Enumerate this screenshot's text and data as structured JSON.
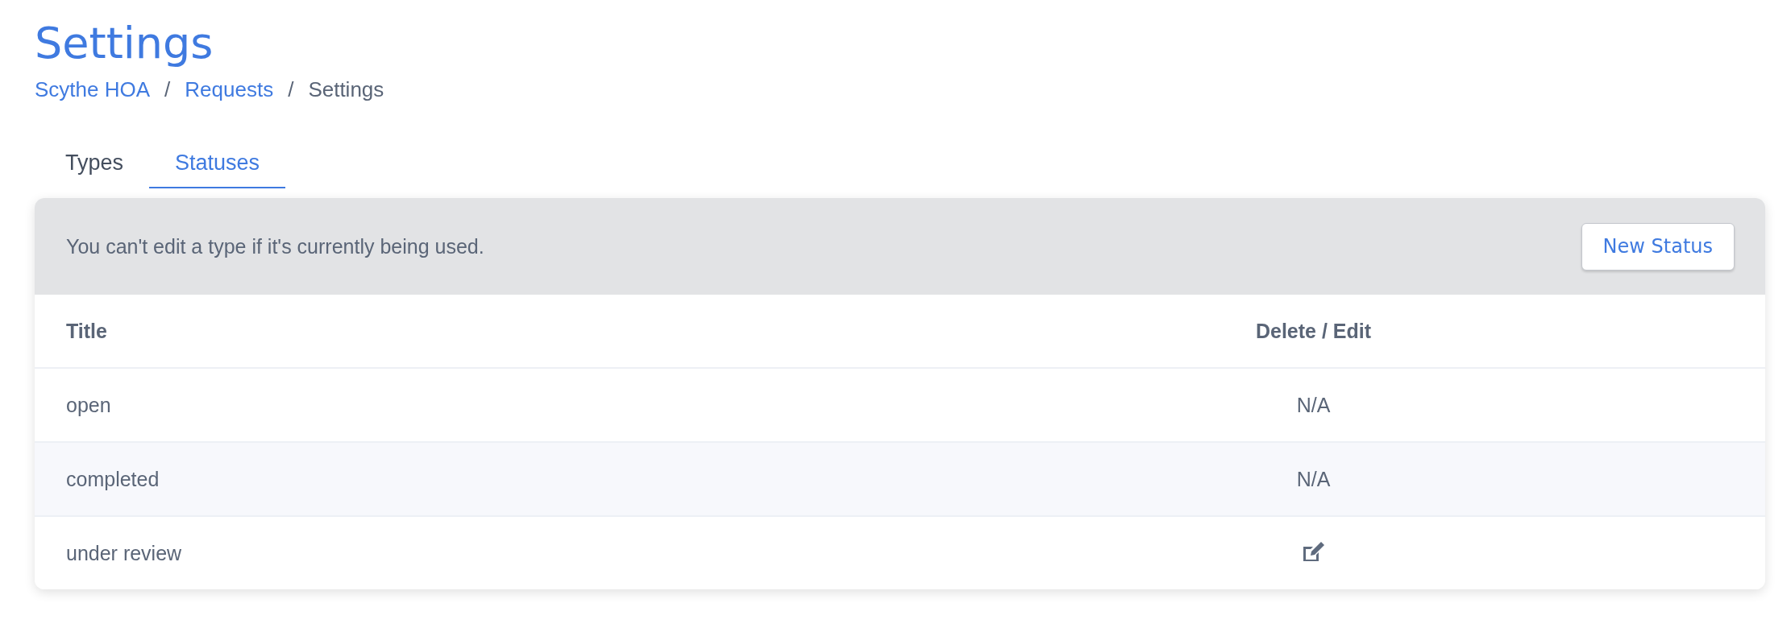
{
  "page_title": "Settings",
  "breadcrumb_separator": "/",
  "breadcrumb": [
    {
      "label": "Scythe HOA",
      "kind": "link"
    },
    {
      "label": "Requests",
      "kind": "link"
    },
    {
      "label": "Settings",
      "kind": "current"
    }
  ],
  "tabs": [
    {
      "label": "Types",
      "selected": false
    },
    {
      "label": "Statuses",
      "selected": true
    }
  ],
  "panel": {
    "notice": "You can't edit a type if it's currently being used.",
    "button": "New Status"
  },
  "table": {
    "columns": [
      "Title",
      "Delete / Edit"
    ],
    "rows": [
      {
        "title": "open",
        "action": {
          "kind": "text",
          "text": "N/A"
        }
      },
      {
        "title": "completed",
        "action": {
          "kind": "text",
          "text": "N/A"
        }
      },
      {
        "title": "under review",
        "action": {
          "kind": "edit"
        }
      }
    ]
  }
}
